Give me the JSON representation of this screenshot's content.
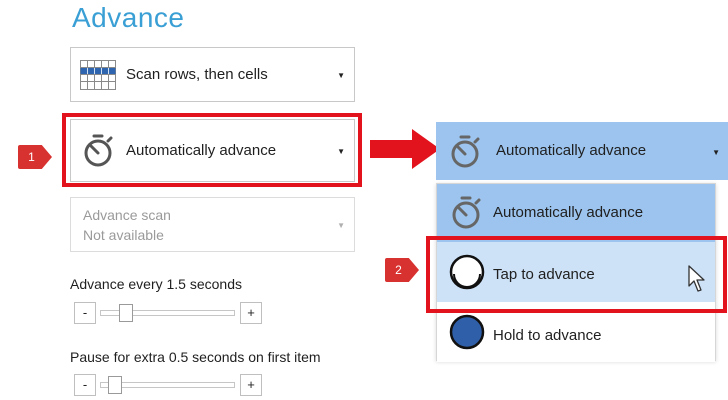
{
  "header": {
    "title": "Advance"
  },
  "scan_mode": {
    "label": "Scan rows, then cells",
    "icon": "grid-icon"
  },
  "advance_mode": {
    "label": "Automatically advance",
    "icon": "timer-icon"
  },
  "advance_scan": {
    "title": "Advance scan",
    "status": "Not available"
  },
  "advance_every": {
    "label": "Advance every 1.5 seconds",
    "value_seconds": 1.5,
    "minus": "-",
    "plus": "+"
  },
  "pause_extra": {
    "label": "Pause for extra 0.5 seconds on first item",
    "value_seconds": 0.5,
    "minus": "-",
    "plus": "+"
  },
  "callouts": {
    "step1": "1",
    "step2": "2"
  },
  "popup": {
    "selected_label": "Automatically advance",
    "options": [
      {
        "label": "Automatically advance",
        "icon": "timer-icon"
      },
      {
        "label": "Tap to advance",
        "icon": "tap-circle-icon"
      },
      {
        "label": "Hold to advance",
        "icon": "hold-circle-icon"
      }
    ]
  },
  "colors": {
    "title": "#3a9fd4",
    "highlight_red": "#e3131e",
    "selected_blue": "#9cc4ee",
    "hover_blue": "#cde2f7",
    "hold_fill": "#2f5fa8",
    "grid_blue": "#2f64ae"
  }
}
